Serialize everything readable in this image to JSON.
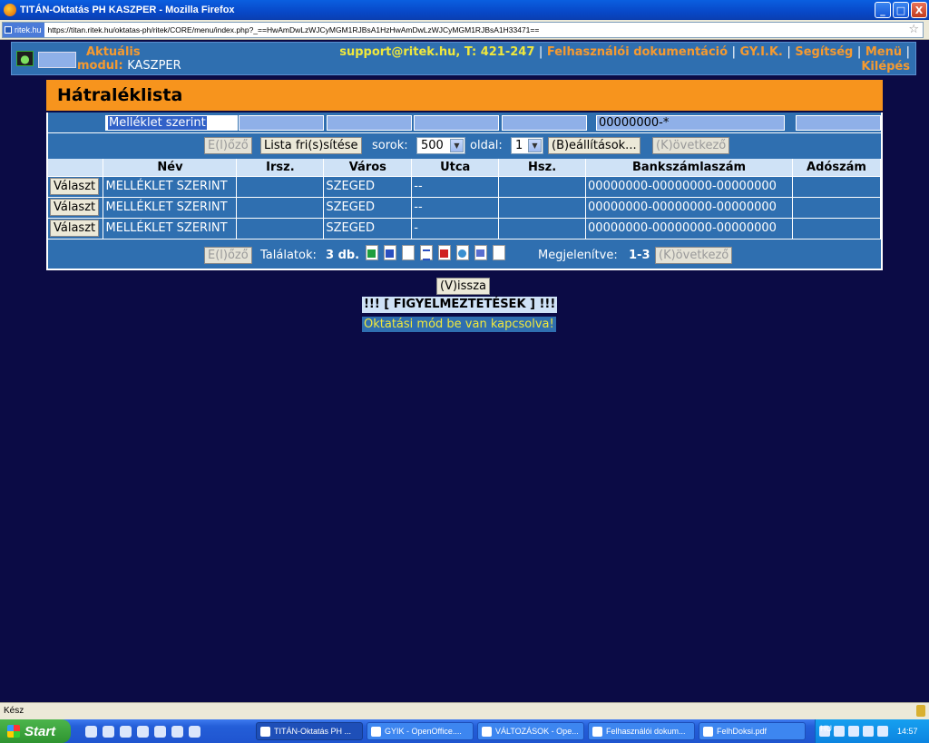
{
  "window": {
    "title": "TITÁN-Oktatás PH KASZPER - Mozilla Firefox",
    "min": "_",
    "max": "□",
    "close": "X"
  },
  "browser": {
    "site_chip": "ritek.hu",
    "url": "https://titan.ritek.hu/oktatas-ph/ritek/CORE/menu/index.php?_==HwAmDwLzWJCyMGM1RJBsA1HzHwAmDwLzWJCyMGM1RJBsA1H33471==",
    "star": "☆",
    "status": "Kész"
  },
  "header": {
    "module_label": "Aktuális",
    "module_label2": "modul:",
    "module_name": "KASZPER",
    "support": "support@ritek.hu, T: 421-247",
    "links": [
      "Felhasználói dokumentáció",
      "GY.I.K.",
      "Segítség",
      "Menü",
      "Kilépés"
    ],
    "sep": "|"
  },
  "panel": {
    "title": "Hátraléklista",
    "filters": [
      "Melléklet szerint",
      "",
      "",
      "",
      "",
      "00000000-*",
      ""
    ],
    "controls": {
      "prev": "E(l)őző",
      "refresh": "Lista fri(s)sítése",
      "rows_label": "sorok:",
      "rows_value": "500",
      "page_label": "oldal:",
      "page_value": "1",
      "settings": "(B)eállítások...",
      "next": "(K)övetkező"
    },
    "columns": [
      "",
      "Név",
      "Irsz.",
      "Város",
      "Utca",
      "Hsz.",
      "Bankszámlaszám",
      "Adószám"
    ],
    "select_label": "Választ",
    "rows": [
      {
        "nev": "MELLÉKLET SZERINT",
        "irsz": "",
        "varos": "SZEGED",
        "utca": "--",
        "hsz": "",
        "bank": "00000000-00000000-00000000",
        "ado": ""
      },
      {
        "nev": "MELLÉKLET SZERINT",
        "irsz": "",
        "varos": "SZEGED",
        "utca": "--",
        "hsz": "",
        "bank": "00000000-00000000-00000000",
        "ado": ""
      },
      {
        "nev": "MELLÉKLET SZERINT",
        "irsz": "",
        "varos": "SZEGED",
        "utca": "-",
        "hsz": "",
        "bank": "00000000-00000000-00000000",
        "ado": ""
      }
    ],
    "footer": {
      "prev": "E(l)őző",
      "results_label": "Találatok:",
      "results_count": "3 db.",
      "shown_label": "Megjelenítve:",
      "shown_range": "1-3",
      "next": "(K)övetkező"
    }
  },
  "back_button": "(V)issza",
  "warnings_title": "!!! [ FIGYELMEZTETÉSEK ] !!!",
  "warning_message": "Oktatási mód be van kapcsolva!",
  "taskbar": {
    "start": "Start",
    "tasks": [
      "TITÁN-Oktatás PH ...",
      "GYIK - OpenOffice....",
      "VÁLTOZÁSOK - Ope...",
      "Felhasználói dokum...",
      "FelhDoksi.pdf"
    ],
    "lang": "HU",
    "clock": "14:57"
  }
}
